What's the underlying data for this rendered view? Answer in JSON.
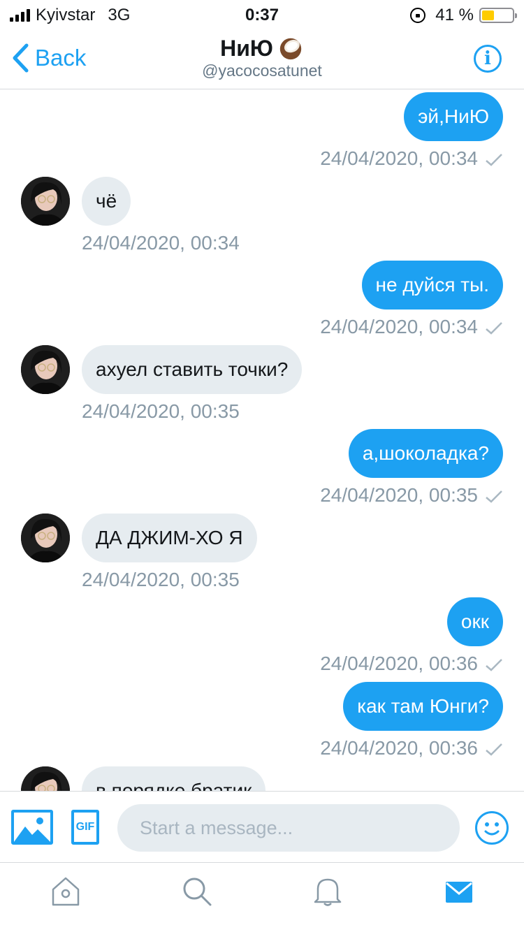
{
  "status_bar": {
    "carrier": "Kyivstar",
    "network": "3G",
    "time": "0:37",
    "battery_percent": "41 %",
    "battery_level": 0.41
  },
  "header": {
    "back_label": "Back",
    "title": "НиЮ",
    "handle": "@yacocosatunet",
    "info_label": "i"
  },
  "messages": [
    {
      "dir": "out",
      "text": "эй,НиЮ",
      "time": "24/04/2020, 00:34"
    },
    {
      "dir": "in",
      "text": "чё",
      "time": "24/04/2020, 00:34"
    },
    {
      "dir": "out",
      "text": "не дуйся ты.",
      "time": "24/04/2020, 00:34"
    },
    {
      "dir": "in",
      "text": "ахуел ставить точки?",
      "time": "24/04/2020, 00:35"
    },
    {
      "dir": "out",
      "text": "а,шоколадка?",
      "time": "24/04/2020, 00:35"
    },
    {
      "dir": "in",
      "text": "ДА ДЖИМ-ХО Я",
      "time": "24/04/2020, 00:35"
    },
    {
      "dir": "out",
      "text": "окк",
      "time": "24/04/2020, 00:36"
    },
    {
      "dir": "out",
      "text": "как там Юнги?",
      "time": "24/04/2020, 00:36"
    },
    {
      "dir": "in",
      "text": "в порядке братик",
      "time": ""
    }
  ],
  "composer": {
    "placeholder": "Start a message...",
    "gif_label": "GIF"
  },
  "tabs": [
    {
      "name": "home",
      "icon": "home-icon"
    },
    {
      "name": "search",
      "icon": "search-icon"
    },
    {
      "name": "notifications",
      "icon": "bell-icon"
    },
    {
      "name": "messages",
      "icon": "mail-icon",
      "active": true
    }
  ],
  "colors": {
    "accent": "#1da1f2",
    "incoming_bubble": "#e6ecf0",
    "timestamp": "#8899a6",
    "battery": "#ffcc00"
  }
}
